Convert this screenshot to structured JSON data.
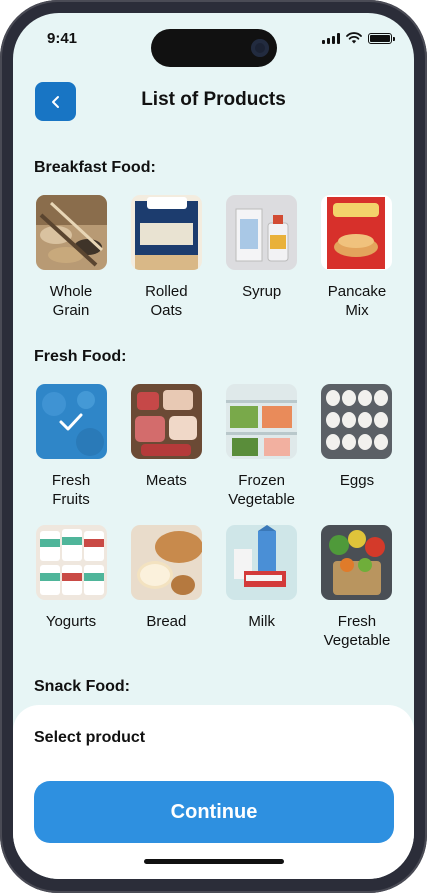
{
  "status_bar": {
    "time": "9:41"
  },
  "header": {
    "title": "List of Products",
    "back_icon": "chevron-left-icon"
  },
  "sections": [
    {
      "title": "Breakfast Food:",
      "items": [
        {
          "label": "Whole\nGrain",
          "selected": false
        },
        {
          "label": "Rolled\nOats",
          "selected": false
        },
        {
          "label": "Syrup",
          "selected": false
        },
        {
          "label": "Pancake\nMix",
          "selected": false
        }
      ]
    },
    {
      "title": "Fresh Food:",
      "items": [
        {
          "label": "Fresh\nFruits",
          "selected": true
        },
        {
          "label": "Meats",
          "selected": false
        },
        {
          "label": "Frozen\nVegetable",
          "selected": false
        },
        {
          "label": "Eggs",
          "selected": false
        },
        {
          "label": "Yogurts",
          "selected": false
        },
        {
          "label": "Bread",
          "selected": false
        },
        {
          "label": "Milk",
          "selected": false
        },
        {
          "label": "Fresh\nVegetable",
          "selected": false
        }
      ]
    },
    {
      "title": "Snack Food:",
      "items": []
    }
  ],
  "bottom_sheet": {
    "select_label": "Select product",
    "continue_label": "Continue"
  },
  "colors": {
    "background": "#e7f5f5",
    "accent": "#1875c4",
    "button": "#2e90e0",
    "selected_overlay": "#2f86c8"
  }
}
